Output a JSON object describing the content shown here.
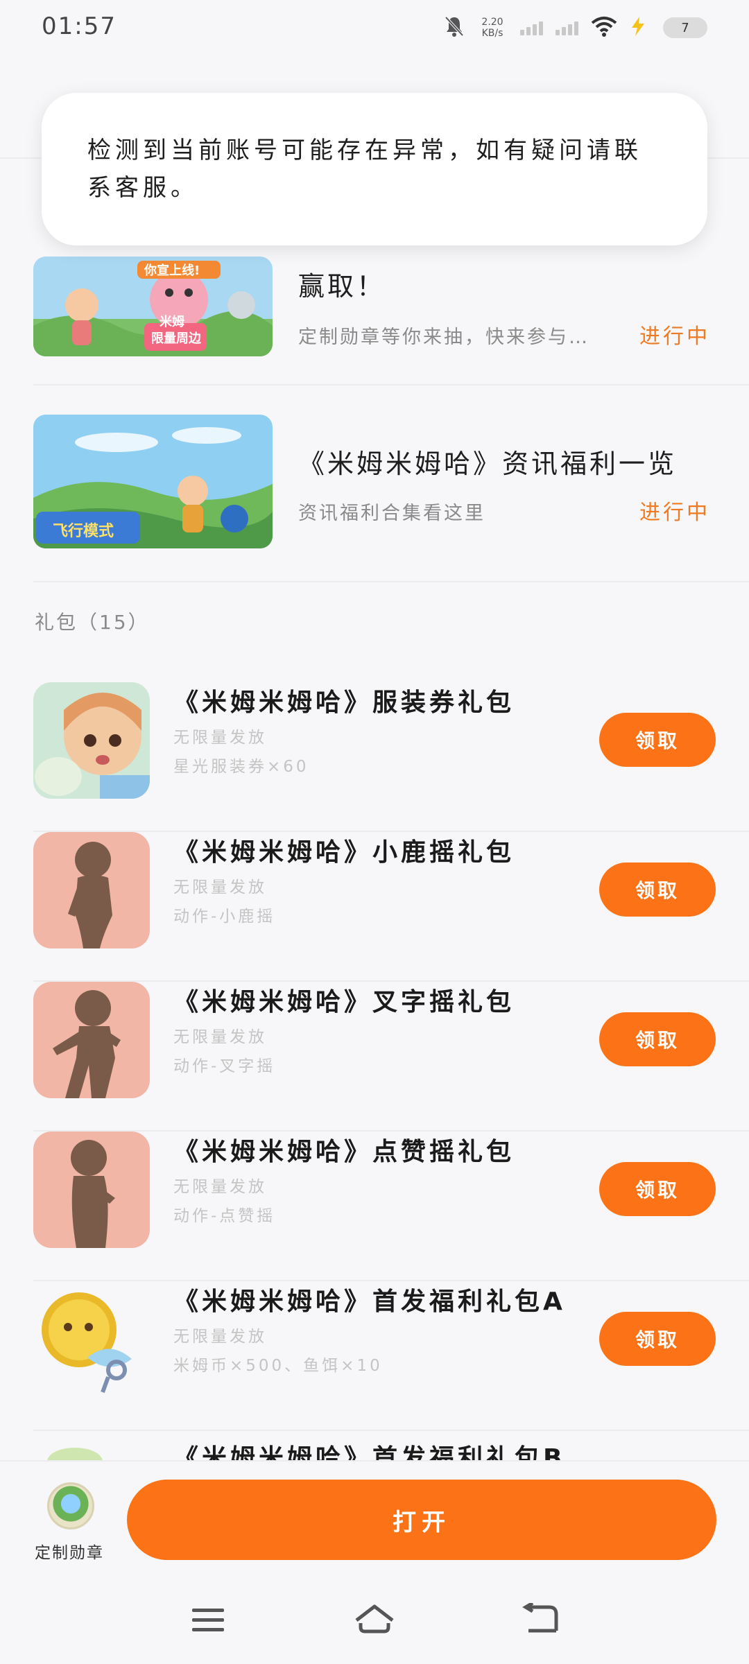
{
  "status_bar": {
    "time": "01:57",
    "net_speed_value": "2.20",
    "net_speed_unit": "KB/s",
    "battery": "7"
  },
  "toast": {
    "message": "检测到当前账号可能存在异常，如有疑问请联系客服。"
  },
  "activities": [
    {
      "title": "赢取！",
      "desc": "定制勋章等你来抽，快来参与…",
      "status": "进行中",
      "banner_text": [
        "你宣上线!",
        "米姆",
        "限量周边"
      ]
    },
    {
      "title": "《米姆米姆哈》资讯福利一览",
      "desc": "资讯福利合集看这里",
      "status": "进行中",
      "banner_text": "飞行模式"
    }
  ],
  "gifts_section": {
    "label": "礼包（15）"
  },
  "gifts": [
    {
      "title": "《米姆米姆哈》服装券礼包",
      "limit": "无限量发放",
      "reward": "星光服装券×60",
      "button": "领取"
    },
    {
      "title": "《米姆米姆哈》小鹿摇礼包",
      "limit": "无限量发放",
      "reward": "动作-小鹿摇",
      "button": "领取"
    },
    {
      "title": "《米姆米姆哈》叉字摇礼包",
      "limit": "无限量发放",
      "reward": "动作-叉字摇",
      "button": "领取"
    },
    {
      "title": "《米姆米姆哈》点赞摇礼包",
      "limit": "无限量发放",
      "reward": "动作-点赞摇",
      "button": "领取"
    },
    {
      "title": "《米姆米姆哈》首发福利礼包A",
      "limit": "无限量发放",
      "reward": "米姆币×500、鱼饵×10",
      "button": "领取"
    },
    {
      "title": "《米姆米姆哈》首发福利礼包B"
    }
  ],
  "bottom_bar": {
    "badge_label": "定制勋章",
    "open_button": "打开"
  },
  "colors": {
    "accent": "#fb7316",
    "status": "#f07a22",
    "background": "#f7f7f9"
  }
}
